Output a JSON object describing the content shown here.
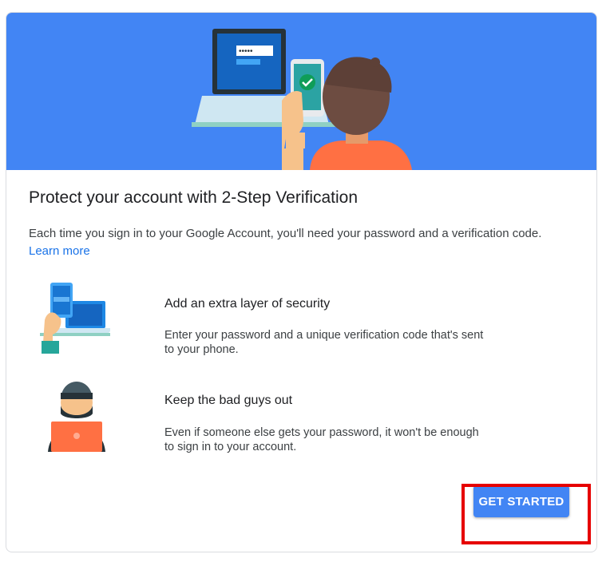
{
  "card": {
    "title": "Protect your account with 2-Step Verification",
    "description": "Each time you sign in to your Google Account, you'll need your password and a verification code.",
    "learn_more": "Learn more"
  },
  "features": [
    {
      "icon": "phone-laptop-illustration",
      "title": "Add an extra layer of security",
      "text": "Enter your password and a unique verification code that's sent to your phone."
    },
    {
      "icon": "hacker-illustration",
      "title": "Keep the bad guys out",
      "text": "Even if someone else gets your password, it won't be enough to sign in to your account."
    }
  ],
  "actions": {
    "get_started": "GET STARTED"
  },
  "colors": {
    "hero_background": "#4285f4",
    "button": "#4285f4",
    "link": "#1a73e8",
    "highlight_box": "#e60000"
  }
}
